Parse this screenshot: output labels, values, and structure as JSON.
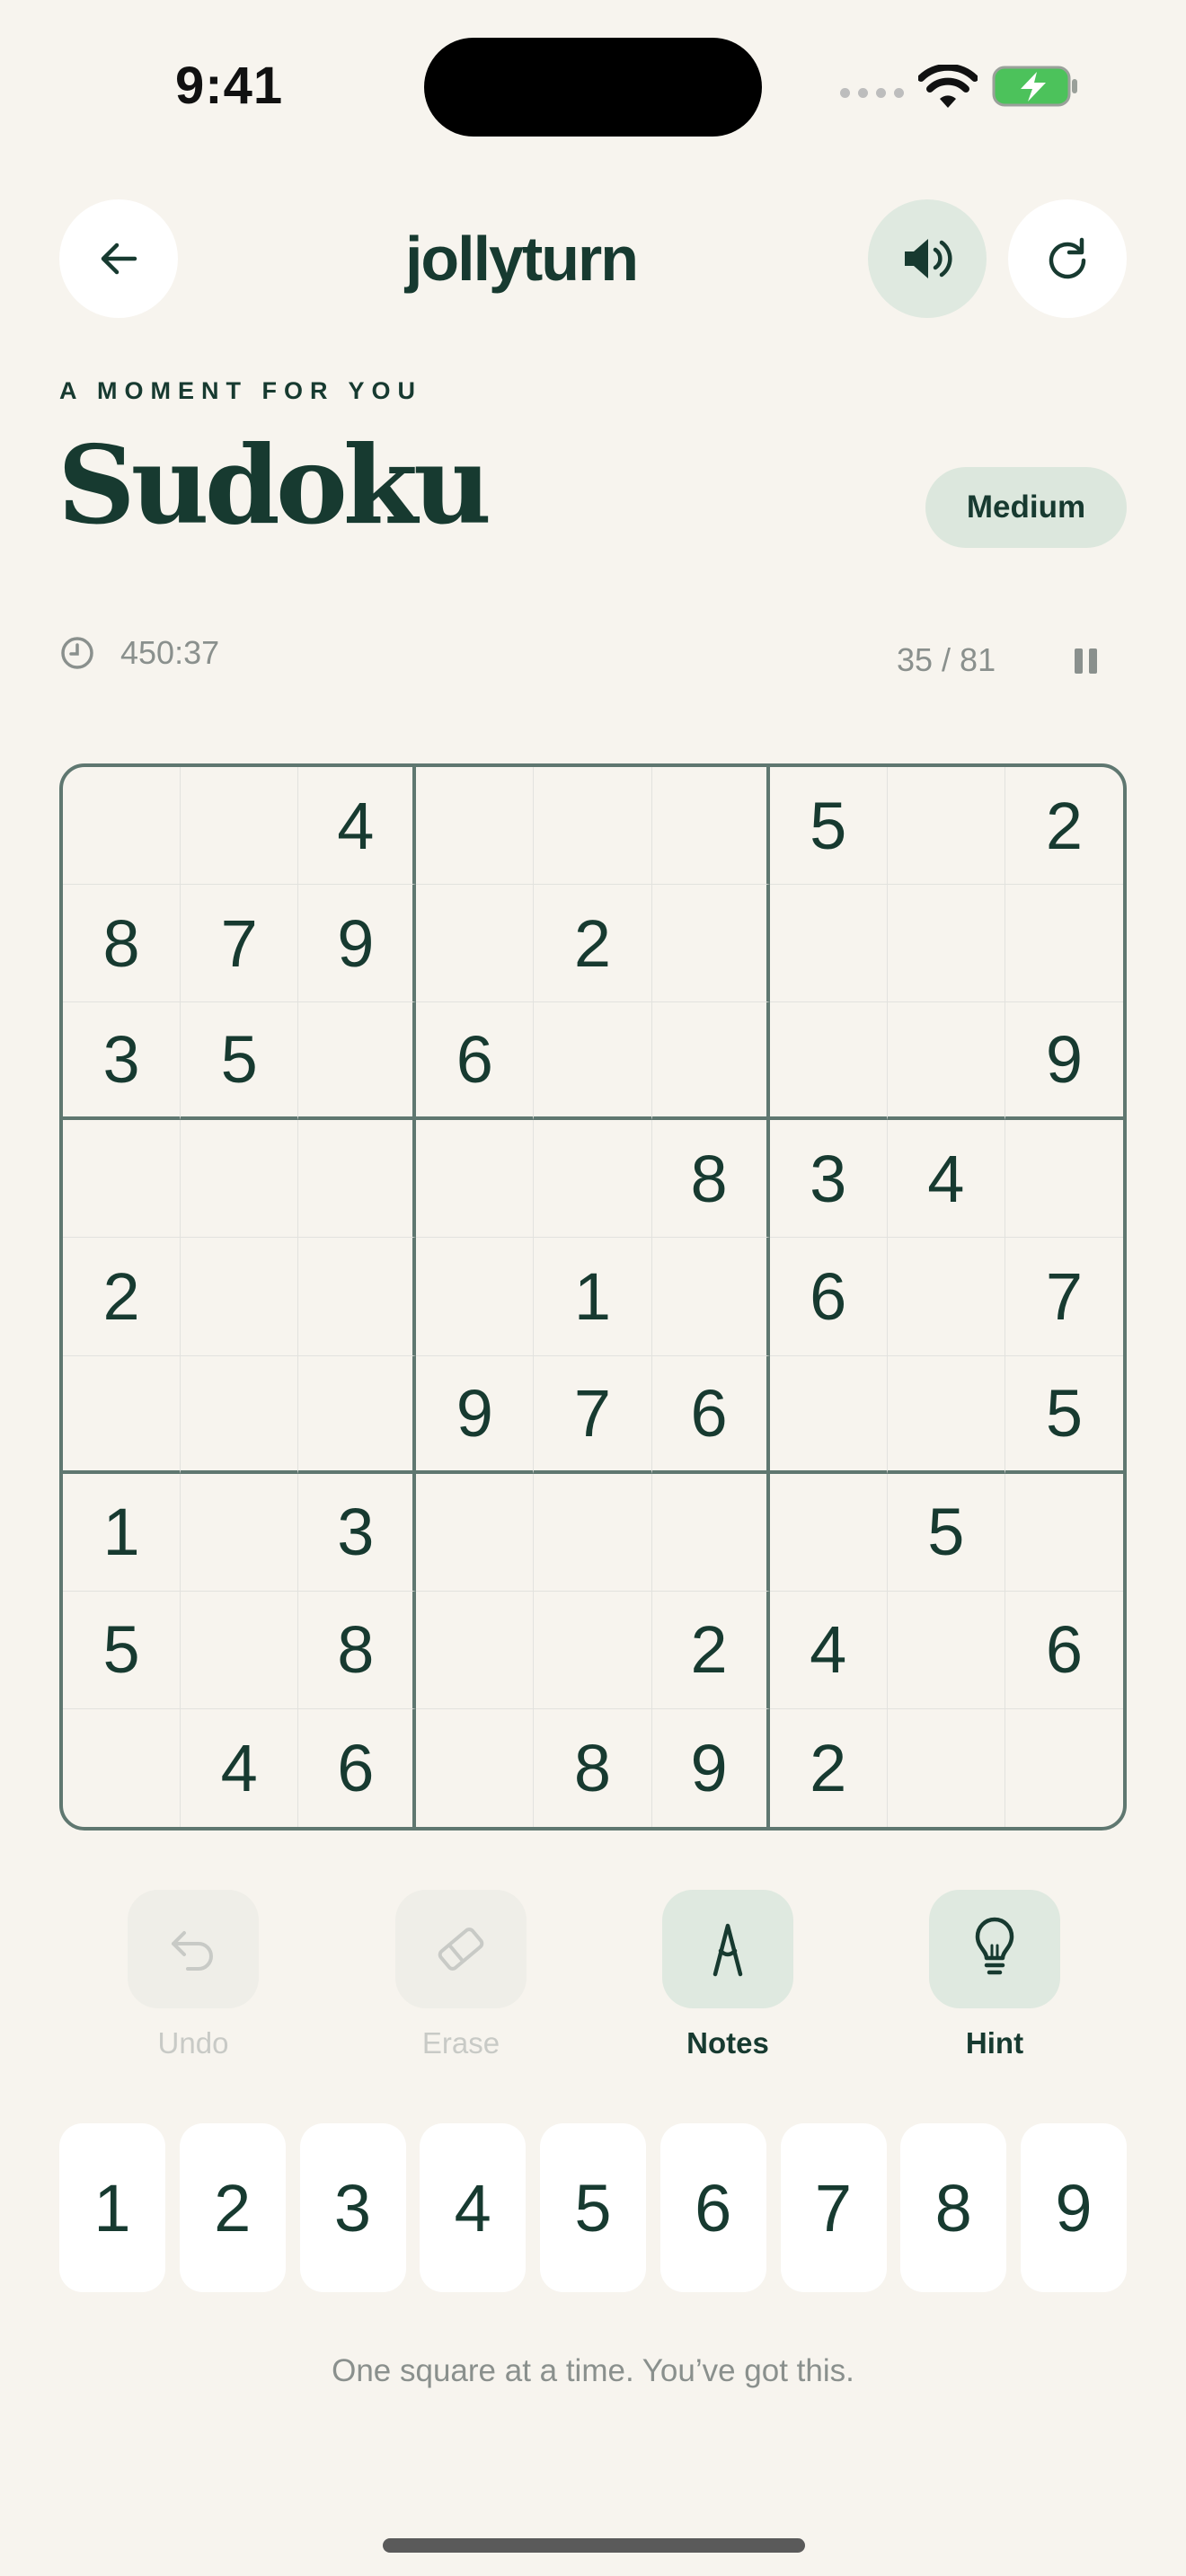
{
  "status": {
    "time": "9:41"
  },
  "header": {
    "brand": "jollyturn",
    "back_icon": "arrow-left-icon",
    "sound_icon": "speaker-icon",
    "restart_icon": "refresh-icon"
  },
  "intro": {
    "eyebrow": "A MOMENT FOR YOU",
    "title": "Sudoku",
    "difficulty": "Medium"
  },
  "stats": {
    "timer": "450:37",
    "progress": "35 / 81"
  },
  "board": [
    [
      "",
      "",
      "4",
      "",
      "",
      "",
      "5",
      "",
      "2"
    ],
    [
      "8",
      "7",
      "9",
      "",
      "2",
      "",
      "",
      "",
      ""
    ],
    [
      "3",
      "5",
      "",
      "6",
      "",
      "",
      "",
      "",
      "9"
    ],
    [
      "",
      "",
      "",
      "",
      "",
      "8",
      "3",
      "4",
      ""
    ],
    [
      "2",
      "",
      "",
      "",
      "1",
      "",
      "6",
      "",
      "7"
    ],
    [
      "",
      "",
      "",
      "9",
      "7",
      "6",
      "",
      "",
      "5"
    ],
    [
      "1",
      "",
      "3",
      "",
      "",
      "",
      "",
      "5",
      ""
    ],
    [
      "5",
      "",
      "8",
      "",
      "",
      "2",
      "4",
      "",
      "6"
    ],
    [
      "",
      "4",
      "6",
      "",
      "8",
      "9",
      "2",
      "",
      ""
    ]
  ],
  "tools": {
    "undo": {
      "label": "Undo",
      "icon": "undo-icon",
      "enabled": false
    },
    "erase": {
      "label": "Erase",
      "icon": "eraser-icon",
      "enabled": false
    },
    "notes": {
      "label": "Notes",
      "icon": "pencil-icon",
      "enabled": true
    },
    "hint": {
      "label": "Hint",
      "icon": "lightbulb-icon",
      "enabled": true
    }
  },
  "keypad": [
    "1",
    "2",
    "3",
    "4",
    "5",
    "6",
    "7",
    "8",
    "9"
  ],
  "footer": {
    "message": "One square at a time. You’ve got this."
  },
  "colors": {
    "background": "#F7F4EE",
    "ink": "#173A30",
    "accent_tint": "#DFE9E0",
    "grid_border": "#5F7770",
    "muted": "#8A908D"
  }
}
